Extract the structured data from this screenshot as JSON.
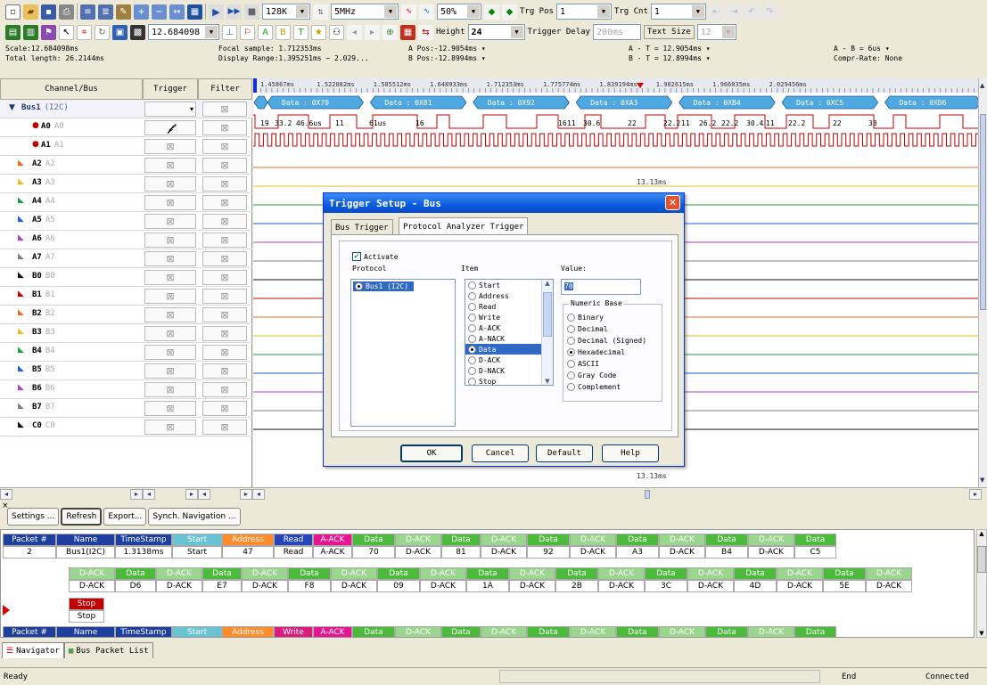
{
  "toolbar1": {
    "sample_depth": "128K",
    "sample_rate": "5MHz",
    "zoom": "50%",
    "trg_pos_label": "Trg Pos",
    "trg_pos_value": "1",
    "trg_cnt_label": "Trg Cnt",
    "trg_cnt_value": "1"
  },
  "toolbar2": {
    "scale_value": "12.684098",
    "height_label": "Height",
    "height_value": "24",
    "trigger_delay_label": "Trigger Delay",
    "trigger_delay_value": "200ms",
    "text_size_label": "Text Size",
    "text_size_value": "12"
  },
  "info": {
    "scale": "Scale:12.684098ms",
    "total_length": "Total length: 26.2144ms",
    "focal_sample": "Focal sample: 1.712353ms",
    "display_range": "Display Range:1.395251ms ~ 2.029...",
    "a_pos": "A Pos:-12.9054ms",
    "b_pos": "B Pos:-12.8994ms",
    "a_t": "A - T = 12.9054ms",
    "b_t": "B - T = 12.8994ms",
    "a_b": "A - B = 6us",
    "compr_rate": "Compr-Rate: None"
  },
  "headers": {
    "channel": "Channel/Bus",
    "trigger": "Trigger",
    "filter": "Filter"
  },
  "bus": {
    "name": "Bus1",
    "tag": "(I2C)"
  },
  "channels": [
    {
      "name": "A0",
      "sub": "A0",
      "color": "#c00000"
    },
    {
      "name": "A1",
      "sub": "A1",
      "color": "#c00000"
    },
    {
      "name": "A2",
      "sub": "A2",
      "color": "#e07030"
    },
    {
      "name": "A3",
      "sub": "A3",
      "color": "#e0c020"
    },
    {
      "name": "A4",
      "sub": "A4",
      "color": "#20a040"
    },
    {
      "name": "A5",
      "sub": "A5",
      "color": "#2060d0"
    },
    {
      "name": "A6",
      "sub": "A6",
      "color": "#b040c0"
    },
    {
      "name": "A7",
      "sub": "A7",
      "color": "#808080"
    },
    {
      "name": "B0",
      "sub": "B0",
      "color": "#101010"
    },
    {
      "name": "B1",
      "sub": "B1",
      "color": "#c00000"
    },
    {
      "name": "B2",
      "sub": "B2",
      "color": "#e07030"
    },
    {
      "name": "B3",
      "sub": "B3",
      "color": "#e0c020"
    },
    {
      "name": "B4",
      "sub": "B4",
      "color": "#20a040"
    },
    {
      "name": "B5",
      "sub": "B5",
      "color": "#2060d0"
    },
    {
      "name": "B6",
      "sub": "B6",
      "color": "#b040c0"
    },
    {
      "name": "B7",
      "sub": "B7",
      "color": "#808080"
    },
    {
      "name": "C0",
      "sub": "C0",
      "color": "#101010"
    }
  ],
  "ruler": [
    "1.45867ms",
    "1.522082ms",
    "1.585512ms",
    "1.648933ms",
    "1.712353ms",
    "1.775774ms",
    "1.839194ms",
    "1.902615ms",
    "1.966035ms",
    "2.029456ms"
  ],
  "bus_packets": [
    "Data : 0X70",
    "Data : 0X81",
    "Data : 0X92",
    "Data : 0XA3",
    "Data : 0XB4",
    "Data : 0XC5",
    "Data : 0XD6"
  ],
  "a0_labels": [
    "19",
    "33.2",
    "46.6us",
    "11",
    "61us",
    "16",
    "16",
    "11",
    "30.6",
    "22",
    "22.2",
    "11",
    "26.2",
    "22.2",
    "30.4",
    "11",
    "22.2",
    "22",
    "33"
  ],
  "cursor_label": "13.13ms",
  "cursor_label_bottom": "13.13ms",
  "wave_line_colors": [
    "#e07030",
    "#e0c020",
    "#20a040",
    "#2060d0",
    "#b040c0",
    "#808080",
    "#101010",
    "#c00000",
    "#e07030",
    "#e0c020",
    "#20a040",
    "#2060d0",
    "#b040c0",
    "#808080",
    "#101010"
  ],
  "dialog": {
    "title": "Trigger Setup - Bus",
    "tab1": "Bus Trigger",
    "tab2": "Protocol Analyzer Trigger",
    "activate": "Activate",
    "protocol_header": "Protocol",
    "item_header": "Item",
    "value_header": "Value:",
    "protocol_item": "Bus1 (I2C)",
    "items": [
      "Start",
      "Address",
      "Read",
      "Write",
      "A-ACK",
      "A-NACK",
      "Data",
      "D-ACK",
      "D-NACK",
      "Stop"
    ],
    "selected_item": "Data",
    "value": "70",
    "numeric_base_title": "Numeric Base",
    "bases": [
      "Binary",
      "Decimal",
      "Decimal (Signed)",
      "Hexadecimal",
      "ASCII",
      "Gray Code",
      "Complement"
    ],
    "selected_base": "Hexadecimal",
    "ok": "OK",
    "cancel": "Cancel",
    "default": "Default",
    "help": "Help"
  },
  "bottom_buttons": {
    "settings": "Settings ...",
    "refresh": "Refresh",
    "export": "Export...",
    "synch": "Synch. Navigation ..."
  },
  "packets": {
    "row1_headers": [
      {
        "t": "Packet #",
        "c": "#1f3f9f"
      },
      {
        "t": "Name",
        "c": "#1f3f9f"
      },
      {
        "t": "TimeStamp",
        "c": "#1f3f9f"
      },
      {
        "t": "Start",
        "c": "#69c3d2"
      },
      {
        "t": "Address",
        "c": "#ff8c2a"
      },
      {
        "t": "Read",
        "c": "#2845b8"
      },
      {
        "t": "A-ACK",
        "c": "#e8138f"
      },
      {
        "t": "Data",
        "c": "#4cbb3c"
      },
      {
        "t": "D-ACK",
        "c": "#9bd68f"
      },
      {
        "t": "Data",
        "c": "#4cbb3c"
      },
      {
        "t": "D-ACK",
        "c": "#9bd68f"
      },
      {
        "t": "Data",
        "c": "#4cbb3c"
      },
      {
        "t": "D-ACK",
        "c": "#9bd68f"
      },
      {
        "t": "Data",
        "c": "#4cbb3c"
      },
      {
        "t": "D-ACK",
        "c": "#9bd68f"
      },
      {
        "t": "Data",
        "c": "#4cbb3c"
      },
      {
        "t": "D-ACK",
        "c": "#9bd68f"
      },
      {
        "t": "Data",
        "c": "#4cbb3c"
      }
    ],
    "row1_values": [
      "2",
      "Bus1(I2C)",
      "1.3138ms",
      "Start",
      "47",
      "Read",
      "A-ACK",
      "70",
      "D-ACK",
      "81",
      "D-ACK",
      "92",
      "D-ACK",
      "A3",
      "D-ACK",
      "B4",
      "D-ACK",
      "C5"
    ],
    "row2_headers": [
      {
        "t": "D-ACK",
        "c": "#9bd68f"
      },
      {
        "t": "Data",
        "c": "#4cbb3c"
      },
      {
        "t": "D-ACK",
        "c": "#9bd68f"
      },
      {
        "t": "Data",
        "c": "#4cbb3c"
      },
      {
        "t": "D-ACK",
        "c": "#9bd68f"
      },
      {
        "t": "Data",
        "c": "#4cbb3c"
      },
      {
        "t": "D-ACK",
        "c": "#9bd68f"
      },
      {
        "t": "Data",
        "c": "#4cbb3c"
      },
      {
        "t": "D-ACK",
        "c": "#9bd68f"
      },
      {
        "t": "Data",
        "c": "#4cbb3c"
      },
      {
        "t": "D-ACK",
        "c": "#9bd68f"
      },
      {
        "t": "Data",
        "c": "#4cbb3c"
      },
      {
        "t": "D-ACK",
        "c": "#9bd68f"
      },
      {
        "t": "Data",
        "c": "#4cbb3c"
      },
      {
        "t": "D-ACK",
        "c": "#9bd68f"
      },
      {
        "t": "Data",
        "c": "#4cbb3c"
      },
      {
        "t": "D-ACK",
        "c": "#9bd68f"
      },
      {
        "t": "Data",
        "c": "#4cbb3c"
      },
      {
        "t": "D-ACK",
        "c": "#9bd68f"
      }
    ],
    "row2_values": [
      "D-ACK",
      "D6",
      "D-ACK",
      "E7",
      "D-ACK",
      "F8",
      "D-ACK",
      "09",
      "D-ACK",
      "1A",
      "D-ACK",
      "2B",
      "D-ACK",
      "3C",
      "D-ACK",
      "4D",
      "D-ACK",
      "5E",
      "D-ACK"
    ],
    "stop_header": "Stop",
    "stop_value": "Stop",
    "row3_headers": [
      {
        "t": "Packet #",
        "c": "#1f3f9f"
      },
      {
        "t": "Name",
        "c": "#1f3f9f"
      },
      {
        "t": "TimeStamp",
        "c": "#1f3f9f"
      },
      {
        "t": "Start",
        "c": "#69c3d2"
      },
      {
        "t": "Address",
        "c": "#ff8c2a"
      },
      {
        "t": "Write",
        "c": "#d81b7d"
      },
      {
        "t": "A-ACK",
        "c": "#e8138f"
      },
      {
        "t": "Data",
        "c": "#4cbb3c"
      },
      {
        "t": "D-ACK",
        "c": "#9bd68f"
      },
      {
        "t": "Data",
        "c": "#4cbb3c"
      },
      {
        "t": "D-ACK",
        "c": "#9bd68f"
      },
      {
        "t": "Data",
        "c": "#4cbb3c"
      },
      {
        "t": "D-ACK",
        "c": "#9bd68f"
      },
      {
        "t": "Data",
        "c": "#4cbb3c"
      },
      {
        "t": "D-ACK",
        "c": "#9bd68f"
      },
      {
        "t": "Data",
        "c": "#4cbb3c"
      },
      {
        "t": "D-ACK",
        "c": "#9bd68f"
      },
      {
        "t": "Data",
        "c": "#4cbb3c"
      }
    ]
  },
  "tabs": {
    "navigator": "Navigator",
    "packet_list": "Bus Packet List"
  },
  "status": {
    "ready": "Ready",
    "end": "End",
    "connected": "Connected"
  }
}
